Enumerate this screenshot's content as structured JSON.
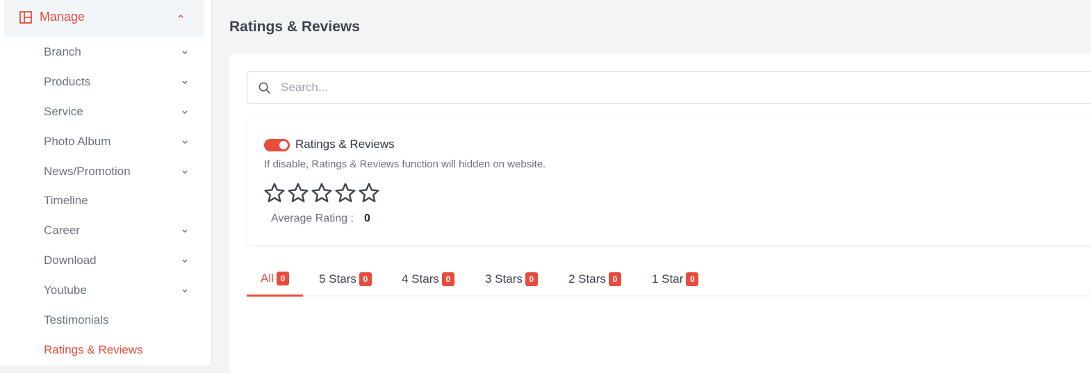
{
  "sidebar": {
    "section": {
      "label": "Manage",
      "icon": "layout-icon",
      "expanded": true
    },
    "items": [
      {
        "label": "Branch",
        "has_children": true
      },
      {
        "label": "Products",
        "has_children": true
      },
      {
        "label": "Service",
        "has_children": true
      },
      {
        "label": "Photo Album",
        "has_children": true
      },
      {
        "label": "News/Promotion",
        "has_children": true
      },
      {
        "label": "Timeline",
        "has_children": false
      },
      {
        "label": "Career",
        "has_children": true
      },
      {
        "label": "Download",
        "has_children": true
      },
      {
        "label": "Youtube",
        "has_children": true
      },
      {
        "label": "Testimonials",
        "has_children": false
      },
      {
        "label": "Ratings & Reviews",
        "has_children": false,
        "active": true
      }
    ]
  },
  "main": {
    "title": "Ratings & Reviews",
    "search": {
      "placeholder": "Search...",
      "value": ""
    },
    "settings": {
      "toggle_label": "Ratings & Reviews",
      "toggle_on": true,
      "description": "If disable, Ratings & Reviews function will hidden on website.",
      "average_rating_label": "Average Rating :",
      "average_rating_value": "0",
      "stars_filled": 0,
      "stars_total": 5
    },
    "tabs": [
      {
        "label": "All",
        "count": "0",
        "active": true
      },
      {
        "label": "5 Stars",
        "count": "0"
      },
      {
        "label": "4 Stars",
        "count": "0"
      },
      {
        "label": "3 Stars",
        "count": "0"
      },
      {
        "label": "2 Stars",
        "count": "0"
      },
      {
        "label": "1 Star",
        "count": "0"
      }
    ]
  },
  "colors": {
    "accent": "#e74c3c",
    "text": "#6b7280",
    "background": "#f3f4f6"
  }
}
